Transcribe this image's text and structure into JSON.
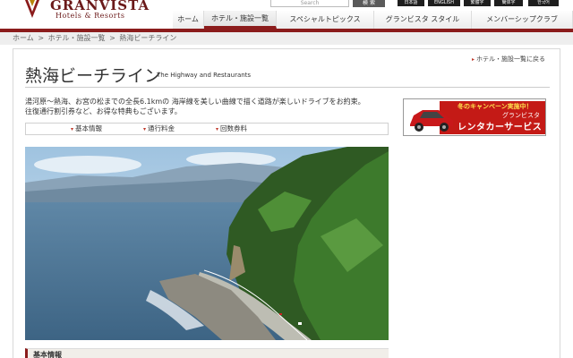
{
  "header": {
    "logo_text": "GRANVISTA",
    "logo_sub": "Hotels & Resorts",
    "search_placeholder": "Search",
    "search_button": "検 索",
    "languages": [
      "日本語",
      "ENGLISH",
      "繁體字",
      "簡体字",
      "한국어"
    ]
  },
  "nav": {
    "items": [
      "ホーム",
      "ホテル・施設一覧",
      "スペシャルトピックス",
      "グランビスタ スタイル",
      "メンバーシップクラブ"
    ],
    "active_index": 1
  },
  "breadcrumb": [
    "ホーム",
    ">",
    "ホテル・施設一覧",
    ">",
    "熱海ビーチライン"
  ],
  "page": {
    "back_link": "ホテル・施設一覧に戻る",
    "title": "熱海ビーチライン",
    "subtitle": "The Highway and Restaurants",
    "description_line1": "湯河原〜熱海、お宮の松までの全長6.1kmの 海岸線を美しい曲線で描く道路が楽しいドライブをお約束。",
    "description_line2": "往復通行割引券など、お得な特典もございます。",
    "tabs": [
      "基本情報",
      "通行料金",
      "回数券料"
    ],
    "section_heading": "基本情報"
  },
  "banner": {
    "top_text": "冬のキャンペーン実施中！",
    "brand_text": "グランビスタ",
    "main_text": "レンタカーサービス"
  },
  "colors": {
    "brand": "#8b1c1c",
    "banner_red": "#c41a16",
    "arrow": "#c0392b"
  }
}
